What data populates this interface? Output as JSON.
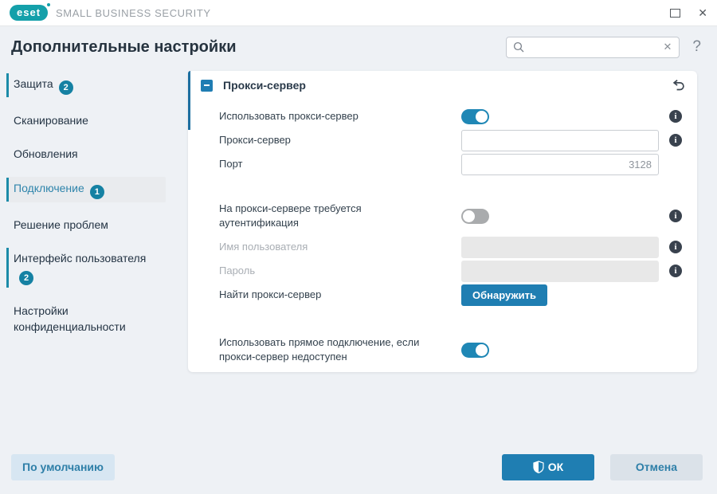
{
  "titlebar": {
    "brand": "eset",
    "product": "SMALL BUSINESS SECURITY"
  },
  "header": {
    "title": "Дополнительные настройки",
    "help": "?"
  },
  "search": {
    "value": "",
    "placeholder": ""
  },
  "icons": {
    "close_window": "✕",
    "clear_search": "✕",
    "collapse": "−",
    "undo": "↺",
    "info": "i"
  },
  "sidebar": {
    "items": [
      {
        "label": "Защита",
        "badge": "2",
        "selected": false,
        "accent": true
      },
      {
        "label": "Сканирование",
        "selected": false,
        "accent": false
      },
      {
        "label": "Обновления",
        "selected": false,
        "accent": false
      },
      {
        "label": "Подключение",
        "badge": "1",
        "selected": true,
        "accent": true
      },
      {
        "label": "Решение проблем",
        "selected": false,
        "accent": false
      },
      {
        "label": "Интерфейс пользователя",
        "badge": "2",
        "selected": false,
        "accent": true
      },
      {
        "label": "Настройки конфиденциальности",
        "selected": false,
        "accent": false
      }
    ]
  },
  "panel": {
    "section_title": "Прокси-сервер",
    "use_proxy": {
      "label": "Использовать прокси-сервер",
      "enabled": true
    },
    "proxy_server": {
      "label": "Прокси-сервер",
      "value": ""
    },
    "port": {
      "label": "Порт",
      "value": "3128"
    },
    "auth": {
      "label": "На прокси-сервере требуется аутентификация",
      "enabled": false
    },
    "username": {
      "label": "Имя пользователя",
      "value": "",
      "disabled": true
    },
    "password": {
      "label": "Пароль",
      "value": "",
      "disabled": true
    },
    "detect": {
      "label": "Найти прокси-сервер",
      "button_label": "Обнаружить"
    },
    "direct": {
      "label": "Использовать прямое подключение, если прокси-сервер недоступен",
      "enabled": true
    }
  },
  "footer": {
    "default_label": "По умолчанию",
    "ok_label": "ОК",
    "cancel_label": "Отмена"
  },
  "colors": {
    "brand_teal": "#14a0aa",
    "accent_blue": "#1f7eb2",
    "toggle_on": "#1f87b5",
    "badge": "#1581a3",
    "selected_text": "#2e84ab",
    "text_dark": "#26333f",
    "background": "#eef1f5",
    "panel": "#ffffff",
    "disabled_input": "#e8e8e8"
  }
}
